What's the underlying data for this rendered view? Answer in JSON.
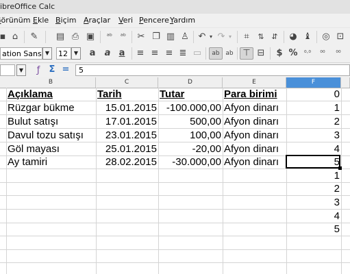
{
  "window": {
    "title": "ibreOffice Calc"
  },
  "menu": [
    "örünüm",
    "Görünüm",
    "Ekle",
    "Biçim",
    "Araçlar",
    "Veri",
    "Pencere",
    "Yardım"
  ],
  "toolbar": {
    "font_name": "ation Sans",
    "font_size": "12"
  },
  "formula_bar": {
    "content": "5"
  },
  "columns": [
    "B",
    "C",
    "D",
    "E",
    "F"
  ],
  "sheet": {
    "headers": {
      "aciklama": "Açıklama",
      "tarih": "Tarih",
      "tutar": "Tutar",
      "para": "Para birimi",
      "f": "0"
    },
    "rows": [
      {
        "aciklama": "Rüzgar bükme",
        "tarih": "15.01.2015",
        "tutar": "-100.000,00",
        "para": "Afyon dinarı",
        "f": "1"
      },
      {
        "aciklama": "Bulut satışı",
        "tarih": "17.01.2015",
        "tutar": "500,00",
        "para": "Afyon dinarı",
        "f": "2"
      },
      {
        "aciklama": "Davul tozu satışı",
        "tarih": "23.01.2015",
        "tutar": "100,00",
        "para": "Afyon dinarı",
        "f": "3"
      },
      {
        "aciklama": "Göl mayası",
        "tarih": "25.01.2015",
        "tutar": "-20,00",
        "para": "Afyon dinarı",
        "f": "4"
      },
      {
        "aciklama": "Ay tamiri",
        "tarih": "28.02.2015",
        "tutar": "-30.000,00",
        "para": "Afyon dinarı",
        "f": "5"
      }
    ],
    "extra_f": [
      "1",
      "2",
      "3",
      "4",
      "5"
    ]
  },
  "colors": {
    "selected_column": "#4a90d9",
    "cursor": "#000000",
    "gridline": "#d4d4d4"
  }
}
